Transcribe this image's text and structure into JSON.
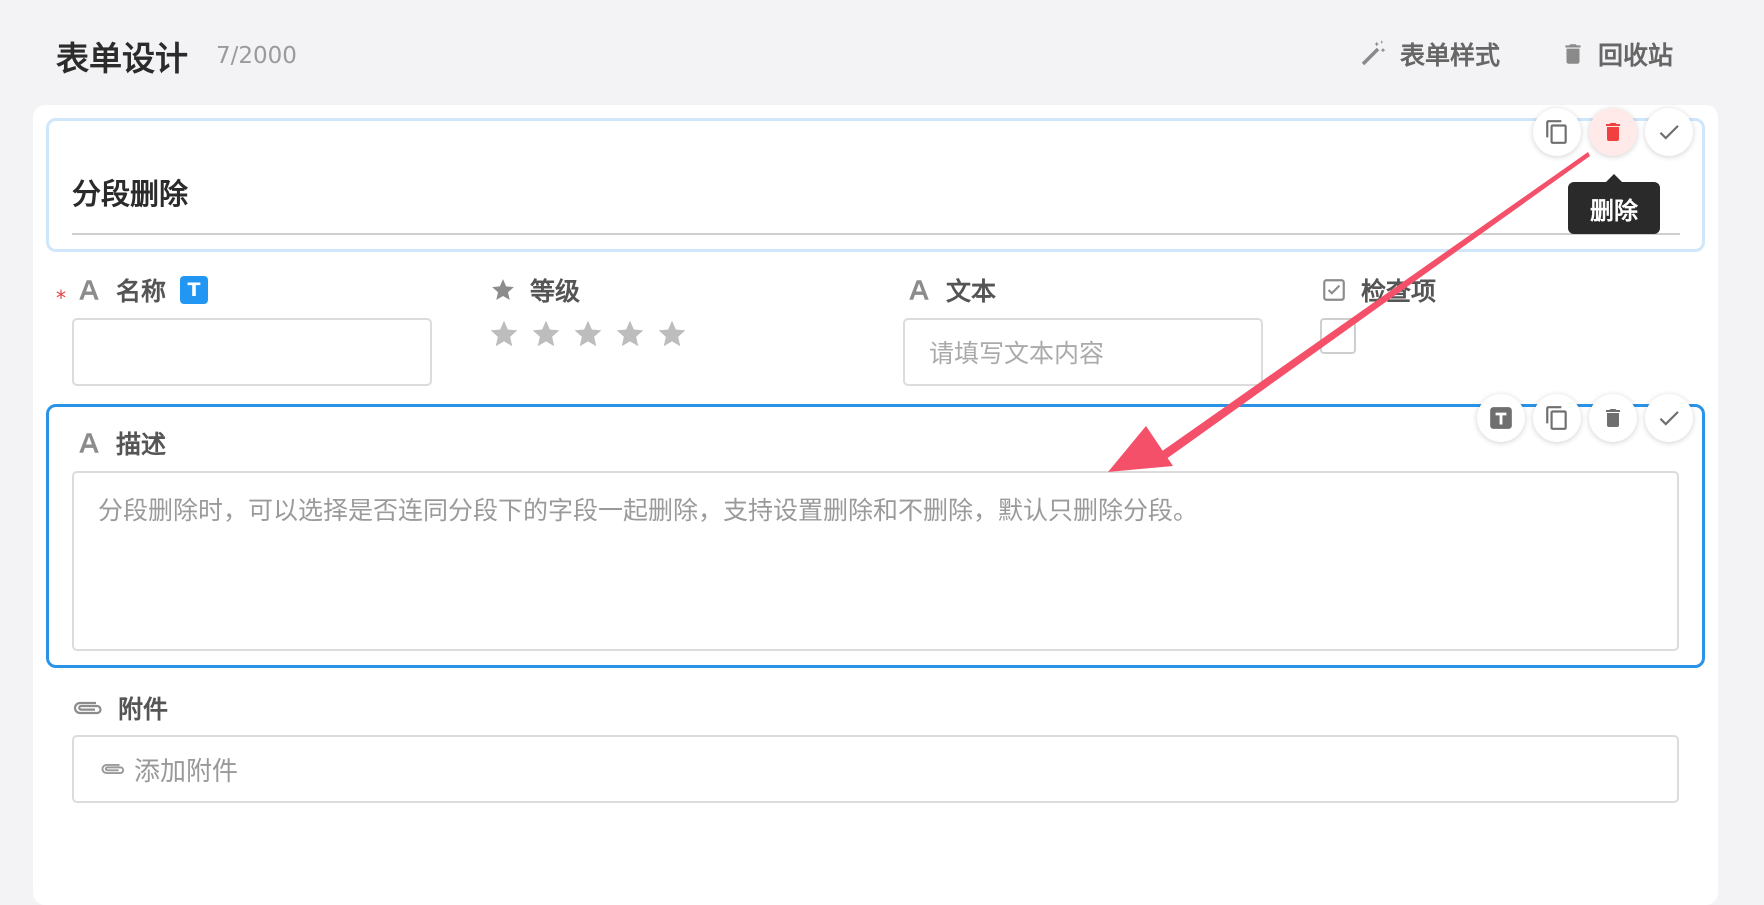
{
  "header": {
    "title": "表单设计",
    "count": "7/2000",
    "style_label": "表单样式",
    "trash_label": "回收站"
  },
  "section": {
    "title": "分段删除",
    "tooltip": "删除"
  },
  "fields": {
    "name": {
      "label": "名称",
      "required_mark": "*",
      "badge": "T"
    },
    "rating": {
      "label": "等级",
      "stars": 5
    },
    "text": {
      "label": "文本",
      "placeholder": "请填写文本内容"
    },
    "check": {
      "label": "检查项"
    },
    "desc": {
      "label": "描述",
      "value": "分段删除时，可以选择是否连同分段下的字段一起删除，支持设置删除和不删除，默认只删除分段。"
    },
    "attach": {
      "label": "附件",
      "button_label": "添加附件"
    }
  },
  "annotation": {
    "arrow_color": "#f4506a"
  },
  "colors": {
    "accent": "#2a93e6",
    "danger": "#f04040"
  }
}
